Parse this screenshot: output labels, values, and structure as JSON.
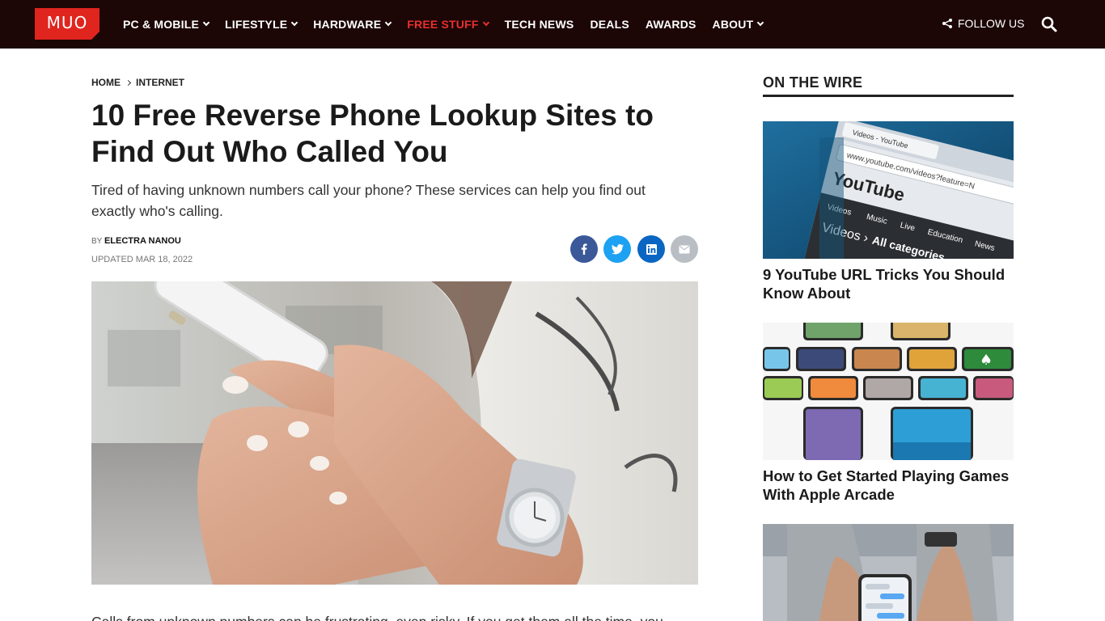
{
  "nav": {
    "logo": "MUO",
    "items": [
      {
        "label": "PC & MOBILE",
        "dropdown": true,
        "active": false
      },
      {
        "label": "LIFESTYLE",
        "dropdown": true,
        "active": false
      },
      {
        "label": "HARDWARE",
        "dropdown": true,
        "active": false
      },
      {
        "label": "FREE STUFF",
        "dropdown": true,
        "active": true
      },
      {
        "label": "TECH NEWS",
        "dropdown": false,
        "active": false
      },
      {
        "label": "DEALS",
        "dropdown": false,
        "active": false
      },
      {
        "label": "AWARDS",
        "dropdown": false,
        "active": false
      },
      {
        "label": "ABOUT",
        "dropdown": true,
        "active": false
      }
    ],
    "follow_label": "FOLLOW US",
    "follow_icon": "share-icon",
    "search_icon": "search-icon"
  },
  "article": {
    "breadcrumb": [
      "HOME",
      "INTERNET"
    ],
    "title": "10 Free Reverse Phone Lookup Sites to Find Out Who Called You",
    "subtitle": "Tired of having unknown numbers call your phone? These services can help you find out exactly who's calling.",
    "by_label": "BY",
    "author": "ELECTRA NANOU",
    "updated": "UPDATED MAR 18, 2022",
    "share": [
      "facebook-icon",
      "twitter-icon",
      "linkedin-icon",
      "email-icon"
    ],
    "body_start": "Calls from unknown numbers can be frustrating, even risky. If you get them all the time, you"
  },
  "sidebar": {
    "heading": "ON THE WIRE",
    "cards": [
      {
        "title": "9 YouTube URL Tricks You Should Know About",
        "image_text": [
          "Videos - YouTube",
          "www.youtube.com/videos?feature=N",
          "YouTube",
          "Videos",
          "Music",
          "Live",
          "Education",
          "News",
          "Videos ›",
          "All categories"
        ]
      },
      {
        "title": "How to Get Started Playing Games With Apple Arcade"
      },
      {
        "title": ""
      }
    ]
  },
  "colors": {
    "nav_bg": "#1c0606",
    "brand_red": "#e0251f",
    "active_nav": "#e8302c",
    "facebook": "#3b5998",
    "twitter": "#1da1f2",
    "linkedin": "#0a66c2",
    "email": "#b9bec4"
  }
}
